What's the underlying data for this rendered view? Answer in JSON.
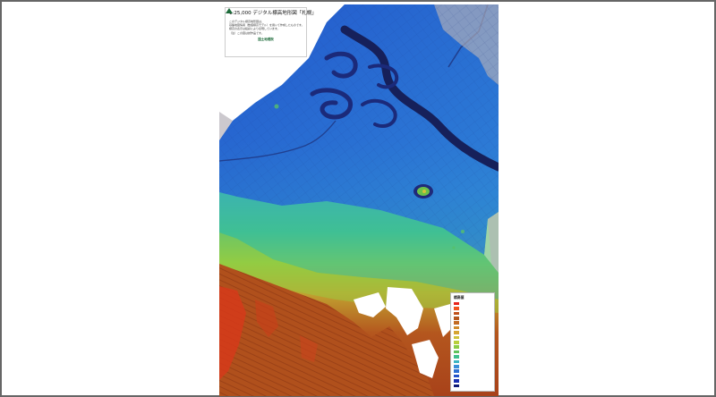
{
  "map": {
    "title": "1:25,000 デジタル標高地形図「札幌」",
    "note_lines": [
      "このデジタル標高地形図は、",
      "基盤地図情報（数値標高モデル）を用いて作成したものです。",
      "標高の表示は段彩により表現しています。",
      "（注）この図は試作品です。"
    ],
    "publisher": "国土地理院",
    "legend": {
      "title": "標高値",
      "entries": [
        {
          "label": "",
          "color": "#e8231b"
        },
        {
          "label": "",
          "color": "#f0531d"
        },
        {
          "label": "",
          "color": "#c0501a"
        },
        {
          "label": "",
          "color": "#b4561e"
        },
        {
          "label": "",
          "color": "#c26a22"
        },
        {
          "label": "",
          "color": "#d08a2a"
        },
        {
          "label": "",
          "color": "#d6a532"
        },
        {
          "label": "",
          "color": "#cfc23a"
        },
        {
          "label": "",
          "color": "#b8cf3c"
        },
        {
          "label": "",
          "color": "#8ccc45"
        },
        {
          "label": "",
          "color": "#5ec35a"
        },
        {
          "label": "",
          "color": "#3fbf8c"
        },
        {
          "label": "",
          "color": "#3bb5c2"
        },
        {
          "label": "",
          "color": "#3a8fd8"
        },
        {
          "label": "",
          "color": "#2f6fd2"
        },
        {
          "label": "",
          "color": "#2451c8"
        },
        {
          "label": "",
          "color": "#1a2fb0"
        },
        {
          "label": "",
          "color": "#101b78"
        }
      ]
    },
    "colors": {
      "lowland": "#2a6fd0",
      "river": "#16205a",
      "mountain": "#b44d1c",
      "peak": "#d63a1a",
      "transition": "#3cbf8a",
      "foothill": "#7fc04a"
    }
  }
}
